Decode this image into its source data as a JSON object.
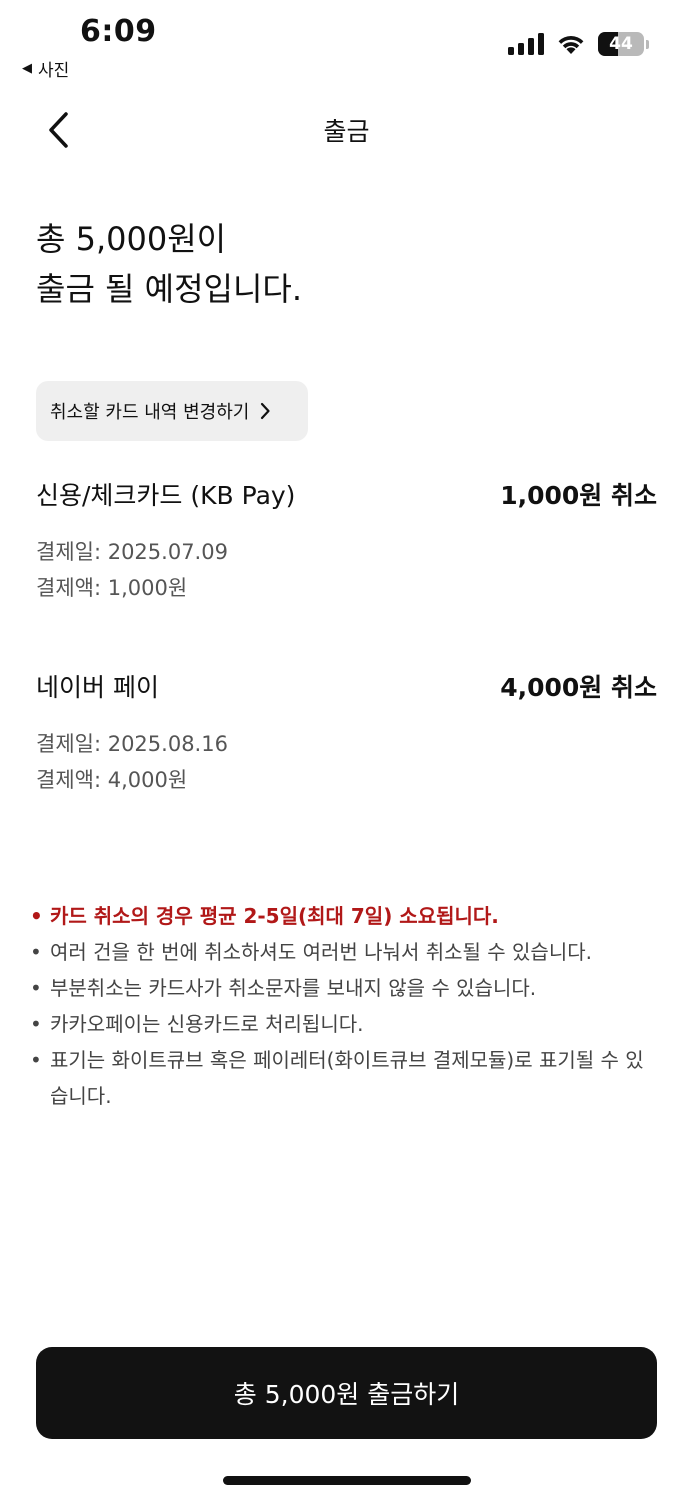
{
  "status_bar": {
    "time": "6:09",
    "back_app": "사진",
    "battery": "44",
    "battery_level": 0.44
  },
  "header": {
    "title": "출금",
    "back_icon": "chevron-left-icon"
  },
  "headline": {
    "line1": "총 5,000원이",
    "line2": "출금 될 예정입니다."
  },
  "change_button": {
    "label": "취소할 카드 내역 변경하기",
    "icon": "chevron-right-icon"
  },
  "payments": [
    {
      "name": "신용/체크카드 (KB Pay)",
      "amount": "1,000원 취소",
      "date": "결제일: 2025.07.09",
      "paid": "결제액: 1,000원"
    },
    {
      "name": "네이버 페이",
      "amount": "4,000원 취소",
      "date": "결제일: 2025.08.16",
      "paid": "결제액: 4,000원"
    }
  ],
  "notes": [
    {
      "text": "카드 취소의 경우 평균 2-5일(최대 7일) 소요됩니다.",
      "warn": true
    },
    {
      "text": "여러 건을 한 번에 취소하셔도 여러번 나눠서 취소될 수 있습니다.",
      "warn": false
    },
    {
      "text": "부분취소는 카드사가 취소문자를 보내지 않을 수 있습니다.",
      "warn": false
    },
    {
      "text": "카카오페이는 신용카드로 처리됩니다.",
      "warn": false
    },
    {
      "text": "표기는 화이트큐브 혹은 페이레터(화이트큐브 결제모듈)로 표기될 수 있습니다.",
      "warn": false
    }
  ],
  "cta": {
    "label": "총 5,000원 출금하기"
  },
  "colors": {
    "warn": "#b11818",
    "cta_bg": "#121212",
    "chip_bg": "#efefef"
  }
}
